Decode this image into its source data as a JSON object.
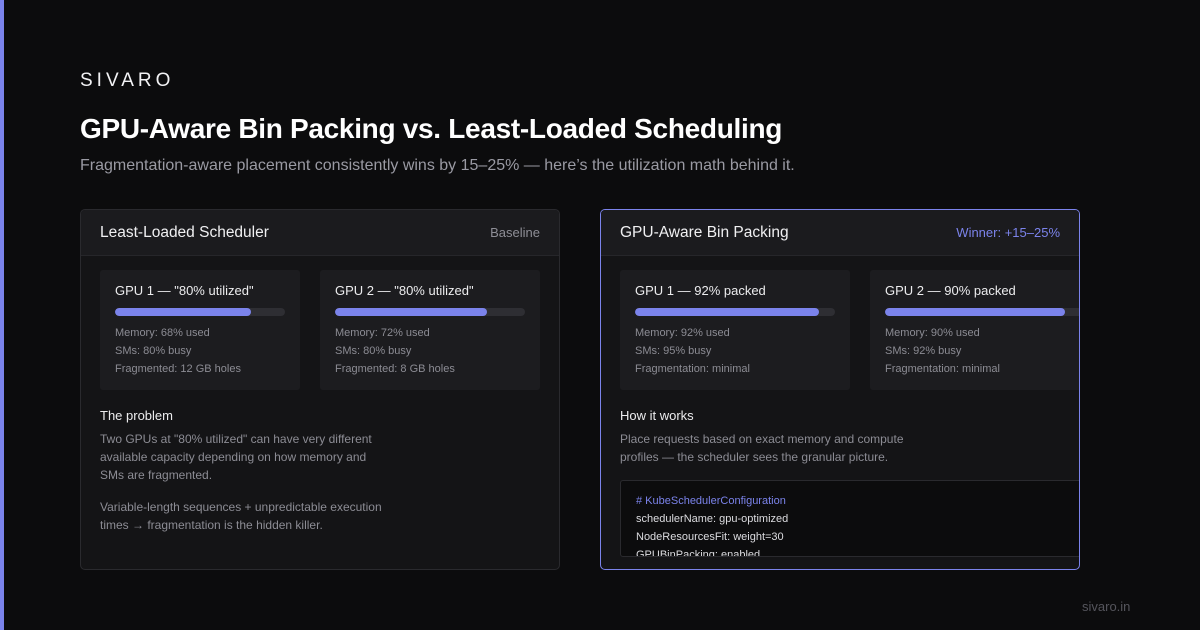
{
  "brand": "SIVARO",
  "title": "GPU-Aware Bin Packing vs. Least-Loaded Scheduling",
  "subtitle": "Fragmentation-aware placement consistently wins by 15–25% — here’s the utilization math behind it.",
  "colors": {
    "accent": "#7b83eb",
    "background": "#0c0c0d",
    "card": "#141416"
  },
  "left_card": {
    "title": "Least-Loaded Scheduler",
    "tag": "Baseline",
    "gpus": [
      {
        "name": "GPU 1 — \"80% utilized\"",
        "fill_percent": 80,
        "stats": [
          "Memory: 68% used",
          "SMs: 80% busy",
          "Fragmented: 12 GB holes"
        ]
      },
      {
        "name": "GPU 2 — \"80% utilized\"",
        "fill_percent": 80,
        "stats": [
          "Memory: 72% used",
          "SMs: 80% busy",
          "Fragmented: 8 GB holes"
        ]
      }
    ],
    "section_title": "The problem",
    "paragraphs": [
      [
        "Two GPUs at \"80% utilized\" can have very different",
        "available capacity depending on how memory and",
        "SMs are fragmented."
      ],
      [
        "Variable-length sequences + unpredictable execution",
        "times → fragmentation is the hidden killer."
      ]
    ]
  },
  "right_card": {
    "title": "GPU-Aware Bin Packing",
    "tag": "Winner: +15–25%",
    "gpus": [
      {
        "name": "GPU 1 — 92% packed",
        "fill_percent": 92,
        "stats": [
          "Memory: 92% used",
          "SMs: 95% busy",
          "Fragmentation: minimal"
        ]
      },
      {
        "name": "GPU 2 — 90% packed",
        "fill_percent": 90,
        "stats": [
          "Memory: 90% used",
          "SMs: 92% busy",
          "Fragmentation: minimal"
        ]
      }
    ],
    "section_title": "How it works",
    "paragraphs": [
      [
        "Place requests based on exact memory and compute",
        "profiles — the scheduler sees the granular picture."
      ]
    ],
    "code": {
      "comment": "# KubeSchedulerConfiguration",
      "lines": [
        "schedulerName: gpu-optimized",
        "NodeResourcesFit: weight=30",
        "GPUBinPacking: enabled"
      ]
    }
  },
  "footer": "sivaro.in"
}
